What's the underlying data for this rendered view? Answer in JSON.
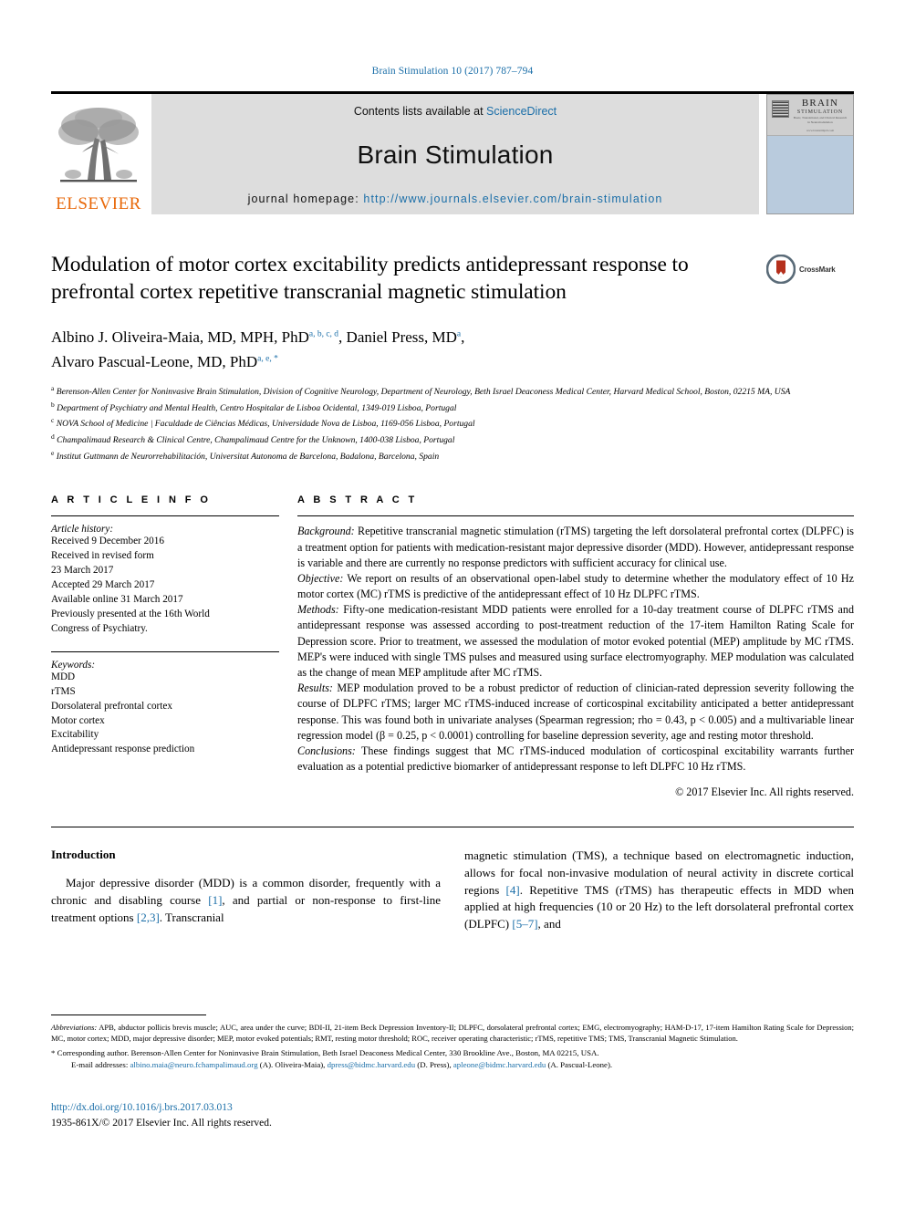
{
  "running_head": "Brain Stimulation 10 (2017) 787–794",
  "masthead": {
    "contents_prefix": "Contents lists available at ",
    "sciencedirect": "ScienceDirect",
    "journal_name": "Brain Stimulation",
    "homepage_prefix": "journal homepage: ",
    "homepage_url": "http://www.journals.elsevier.com/brain-stimulation",
    "publisher": "ELSEVIER",
    "cover": {
      "line1": "BRAIN",
      "line2": "STIMULATION",
      "line3": "Basic, Translational, and Clinical Research in Neuromodulation",
      "line4": "www.brainstimjrnl.com"
    },
    "accent_blue": "#1a6ea8",
    "elsevier_orange": "#e8690b"
  },
  "crossmark": {
    "label": "CrossMark"
  },
  "article": {
    "title": "Modulation of motor cortex excitability predicts antidepressant response to prefrontal cortex repetitive transcranial magnetic stimulation",
    "authors": [
      {
        "name": "Albino J. Oliveira-Maia, MD, MPH, PhD",
        "marks": "a, b, c, d",
        "sep": ", "
      },
      {
        "name": "Daniel Press, MD",
        "marks": "a",
        "sep": ","
      },
      {
        "name": "Alvaro Pascual-Leone, MD, PhD",
        "marks": "a, e, *",
        "sep": ""
      }
    ],
    "affiliations": [
      {
        "mark": "a",
        "text": "Berenson-Allen Center for Noninvasive Brain Stimulation, Division of Cognitive Neurology, Department of Neurology, Beth Israel Deaconess Medical Center, Harvard Medical School, Boston, 02215 MA, USA"
      },
      {
        "mark": "b",
        "text": "Department of Psychiatry and Mental Health, Centro Hospitalar de Lisboa Ocidental, 1349-019 Lisboa, Portugal"
      },
      {
        "mark": "c",
        "text": "NOVA School of Medicine | Faculdade de Ciências Médicas, Universidade Nova de Lisboa, 1169-056 Lisboa, Portugal"
      },
      {
        "mark": "d",
        "text": "Champalimaud Research & Clinical Centre, Champalimaud Centre for the Unknown, 1400-038 Lisboa, Portugal"
      },
      {
        "mark": "e",
        "text": "Institut Guttmann de Neurorrehabilitación, Universitat Autonoma de Barcelona, Badalona, Barcelona, Spain"
      }
    ]
  },
  "article_info": {
    "heading": "A R T I C L E   I N F O",
    "history_label": "Article history:",
    "history_lines": [
      "Received 9 December 2016",
      "Received in revised form",
      "23 March 2017",
      "Accepted 29 March 2017",
      "Available online 31 March 2017",
      "Previously presented at the 16th World",
      "Congress of Psychiatry."
    ],
    "keywords_label": "Keywords:",
    "keywords": [
      "MDD",
      "rTMS",
      "Dorsolateral prefrontal cortex",
      "Motor cortex",
      "Excitability",
      "Antidepressant response prediction"
    ]
  },
  "abstract": {
    "heading": "A B S T R A C T",
    "sections": [
      {
        "label": "Background:",
        "text": " Repetitive transcranial magnetic stimulation (rTMS) targeting the left dorsolateral prefrontal cortex (DLPFC) is a treatment option for patients with medication-resistant major depressive disorder (MDD). However, antidepressant response is variable and there are currently no response predictors with sufficient accuracy for clinical use."
      },
      {
        "label": "Objective:",
        "text": " We report on results of an observational open-label study to determine whether the modulatory effect of 10 Hz motor cortex (MC) rTMS is predictive of the antidepressant effect of 10 Hz DLPFC rTMS."
      },
      {
        "label": "Methods:",
        "text": " Fifty-one medication-resistant MDD patients were enrolled for a 10-day treatment course of DLPFC rTMS and antidepressant response was assessed according to post-treatment reduction of the 17-item Hamilton Rating Scale for Depression score. Prior to treatment, we assessed the modulation of motor evoked potential (MEP) amplitude by MC rTMS. MEP's were induced with single TMS pulses and measured using surface electromyography. MEP modulation was calculated as the change of mean MEP amplitude after MC rTMS."
      },
      {
        "label": "Results:",
        "text": " MEP modulation proved to be a robust predictor of reduction of clinician-rated depression severity following the course of DLPFC rTMS; larger MC rTMS-induced increase of corticospinal excitability anticipated a better antidepressant response. This was found both in univariate analyses (Spearman regression; rho = 0.43, p < 0.005) and a multivariable linear regression model (β = 0.25, p < 0.0001) controlling for baseline depression severity, age and resting motor threshold."
      },
      {
        "label": "Conclusions:",
        "text": " These findings suggest that MC rTMS-induced modulation of corticospinal excitability warrants further evaluation as a potential predictive biomarker of antidepressant response to left DLPFC 10 Hz rTMS."
      }
    ],
    "copyright": "© 2017 Elsevier Inc. All rights reserved."
  },
  "introduction": {
    "heading": "Introduction",
    "col1_part1": "Major depressive disorder (MDD) is a common disorder, frequently with a chronic and disabling course ",
    "col1_ref1": "[1]",
    "col1_part2": ", and partial or non-response to first-line treatment options ",
    "col1_ref2": "[2,3]",
    "col1_part3": ". Transcranial",
    "col2_part1": "magnetic stimulation (TMS), a technique based on electromagnetic induction, allows for focal non-invasive modulation of neural activity in discrete cortical regions ",
    "col2_ref1": "[4]",
    "col2_part2": ". Repetitive TMS (rTMS) has therapeutic effects in MDD when applied at high frequencies (10 or 20 Hz) to the left dorsolateral prefrontal cortex (DLPFC) ",
    "col2_ref2": "[5–7]",
    "col2_part3": ", and"
  },
  "footnotes": {
    "abbrev_label": "Abbreviations:",
    "abbrev_text": " APB, abductor pollicis brevis muscle; AUC, area under the curve; BDI-II, 21-item Beck Depression Inventory-II; DLPFC, dorsolateral prefrontal cortex; EMG, electromyography; HAM-D-17, 17-item Hamilton Rating Scale for Depression; MC, motor cortex; MDD, major depressive disorder; MEP, motor evoked potentials; RMT, resting motor threshold; ROC, receiver operating characteristic; rTMS, repetitive TMS; TMS, Transcranial Magnetic Stimulation.",
    "corresponding": "Corresponding author. Berenson-Allen Center for Noninvasive Brain Stimulation, Beth Israel Deaconess Medical Center, 330 Brookline Ave., Boston, MA 02215, USA.",
    "email_label": "E-mail addresses:",
    "emails": [
      {
        "address": "albino.maia@neuro.fchampalimaud.org",
        "owner": " (A). Oliveira-Maia), "
      },
      {
        "address": "dpress@bidmc.harvard.edu",
        "owner": " (D. Press), "
      },
      {
        "address": "apleone@bidmc.harvard.edu",
        "owner": " (A. Pascual-Leone)."
      }
    ]
  },
  "bottom": {
    "doi": "http://dx.doi.org/10.1016/j.brs.2017.03.013",
    "issn_copyright": "1935-861X/© 2017 Elsevier Inc. All rights reserved."
  }
}
